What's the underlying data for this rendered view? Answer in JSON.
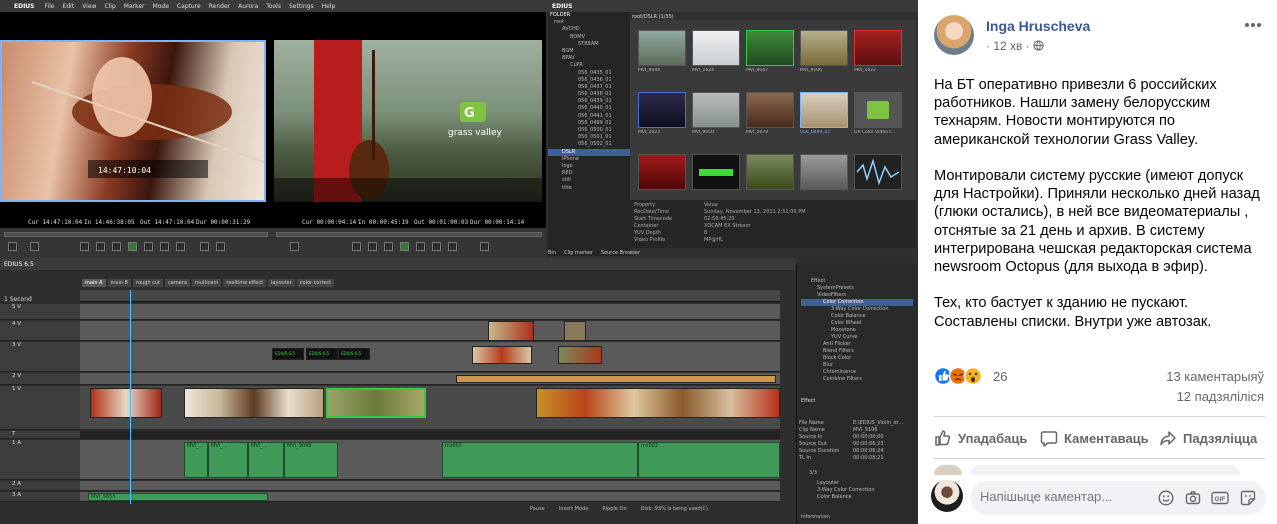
{
  "edius": {
    "brand": "EDIUS",
    "menu": [
      "File",
      "Edit",
      "View",
      "Clip",
      "Marker",
      "Mode",
      "Capture",
      "Render",
      "Aurora",
      "Tools",
      "Settings",
      "Help"
    ],
    "player": {
      "timecode_overlay": "14:47:10:04",
      "cur": "Cur 14:47:10:04",
      "in": "In 14:46:38:05",
      "out": "Out 14:47:10:04",
      "dur": "Dur 00:00:31:29"
    },
    "recorder": {
      "cur": "Cur 00:00:04:14",
      "in": "In 00:00:45:19",
      "out": "Out 00:01:00:03",
      "dur": "Dur 00:00:14:14",
      "logo_text": "grass valley"
    },
    "bin": {
      "title": "EDIUS",
      "folder_label": "FOLDER",
      "path": "root/DSLR (1/35)",
      "folders": [
        "root",
        "AVCHD",
        "BDMV",
        "STREAM",
        "BGM",
        "BPAV",
        "CLPR",
        "056_0435_01",
        "056_0436_01",
        "056_0437_01",
        "056_0438_01",
        "056_0439_01",
        "056_0440_01",
        "056_0441_01",
        "056_0499_01",
        "056_0500_01",
        "056_0501_01",
        "056_0502_01",
        "DSLR",
        "iPhone",
        "logo",
        "RED",
        "still",
        "title"
      ],
      "clips": [
        "MVI_9044",
        "MVI_1624",
        "MVI_9047",
        "MVI_9106",
        "MVI_1622",
        "MVI_1623",
        "MVI_9050",
        "MVI_5679",
        "056_0499_01",
        "GV Color Video F...",
        "",
        "",
        "",
        "",
        ""
      ],
      "properties": [
        {
          "key": "Property",
          "value": "Value"
        },
        {
          "key": "RecDate/Time",
          "value": "Sunday, November 13, 2011 2:51:00 PM"
        },
        {
          "key": "Start Timecode",
          "value": "02:56:45:20"
        },
        {
          "key": "Container",
          "value": "XDCAM EX Stream"
        },
        {
          "key": "YUV Depth",
          "value": "8"
        },
        {
          "key": "Video Profile",
          "value": "MP@HL"
        }
      ],
      "tabs": [
        "Bin",
        "Clip marker",
        "Source Browser"
      ]
    },
    "timeline": {
      "project": "EDIUS 6.5",
      "scale": "1 Second",
      "sequence_tabs": [
        "main A",
        "main B",
        "rough cut",
        "camera",
        "multicam",
        "realtime effect",
        "layouter",
        "color correct"
      ],
      "tracks": [
        "5 V",
        "4 V",
        "3 V",
        "2 V",
        "1 V",
        "T",
        "1 A",
        "2 A",
        "3 A"
      ],
      "audio_clips": [
        "MVI_...",
        "MVI_...",
        "MVI_...",
        "MVI_9048",
        "ms001",
        "ms002",
        "MVI_5653"
      ],
      "title_clips": [
        "EDIUS 6.5",
        "EDIUS 6.5",
        "EDIUS 6.5"
      ],
      "status": [
        "Pause",
        "Insert Mode",
        "Ripple On",
        "Disk: 93% is being used(C)"
      ]
    },
    "effects": {
      "tree": [
        "Effect",
        "SystemPresets",
        "VideoFilters",
        "Color Correction",
        "3-Way Color Correction",
        "Color Balance",
        "Color Wheel",
        "Monotone",
        "YUV Curve",
        "Anti Flicker",
        "Blend Filters",
        "Block Color",
        "Blur",
        "Chrominance",
        "Combine Filters"
      ],
      "tab": "Effect",
      "info": [
        {
          "key": "File Name",
          "value": "E:\\EDIUS_Violin_dr..."
        },
        {
          "key": "Clip Name",
          "value": "MVI_9106"
        },
        {
          "key": "Source In",
          "value": "00:00:00;00"
        },
        {
          "key": "Source Out",
          "value": "00:00:06;23"
        },
        {
          "key": "Source Duration",
          "value": "00:00:06;24"
        },
        {
          "key": "TL In",
          "value": "00:00:08;21"
        }
      ],
      "layers_count": "3/3",
      "layers": [
        "Layouter",
        "3-Way Color Correction",
        "Color Balance"
      ],
      "info_tab": "Information"
    },
    "colors": {
      "clip_green": "#3f9a58",
      "monitor_border": "#7fb2ff"
    }
  },
  "post": {
    "author": "Inga Hruscheva",
    "time": "12 хв",
    "audience_icon": "globe-icon",
    "paragraphs": [
      "На БТ оперативно привезли 6 российских работников. Нашли замену белорусским технарям. Новости монтируются по американской технологии Grass Valley.",
      "Монтировали систему русские (имеют допуск для Настройки). Приняли несколько дней назад (глюки остались), в ней все видеоматериалы , отснятые за 21 день и архив. В систему интегрирована чешская редакторская система newsroom Octopus (для выхода в эфир).",
      "Тех, кто бастует к зданию не пускают. Составлены списки. Внутри уже автозак."
    ],
    "reactions": {
      "icons": [
        "like-icon",
        "angry-icon",
        "wow-icon"
      ],
      "count": "26"
    },
    "comments_count": "13 каментарыяў",
    "shares_count": "12 падзяліліся",
    "actions": {
      "like": "Упадабаць",
      "comment": "Каментаваць",
      "share": "Падзяліцца"
    },
    "comment_placeholder": "Напішыце каментар..."
  }
}
